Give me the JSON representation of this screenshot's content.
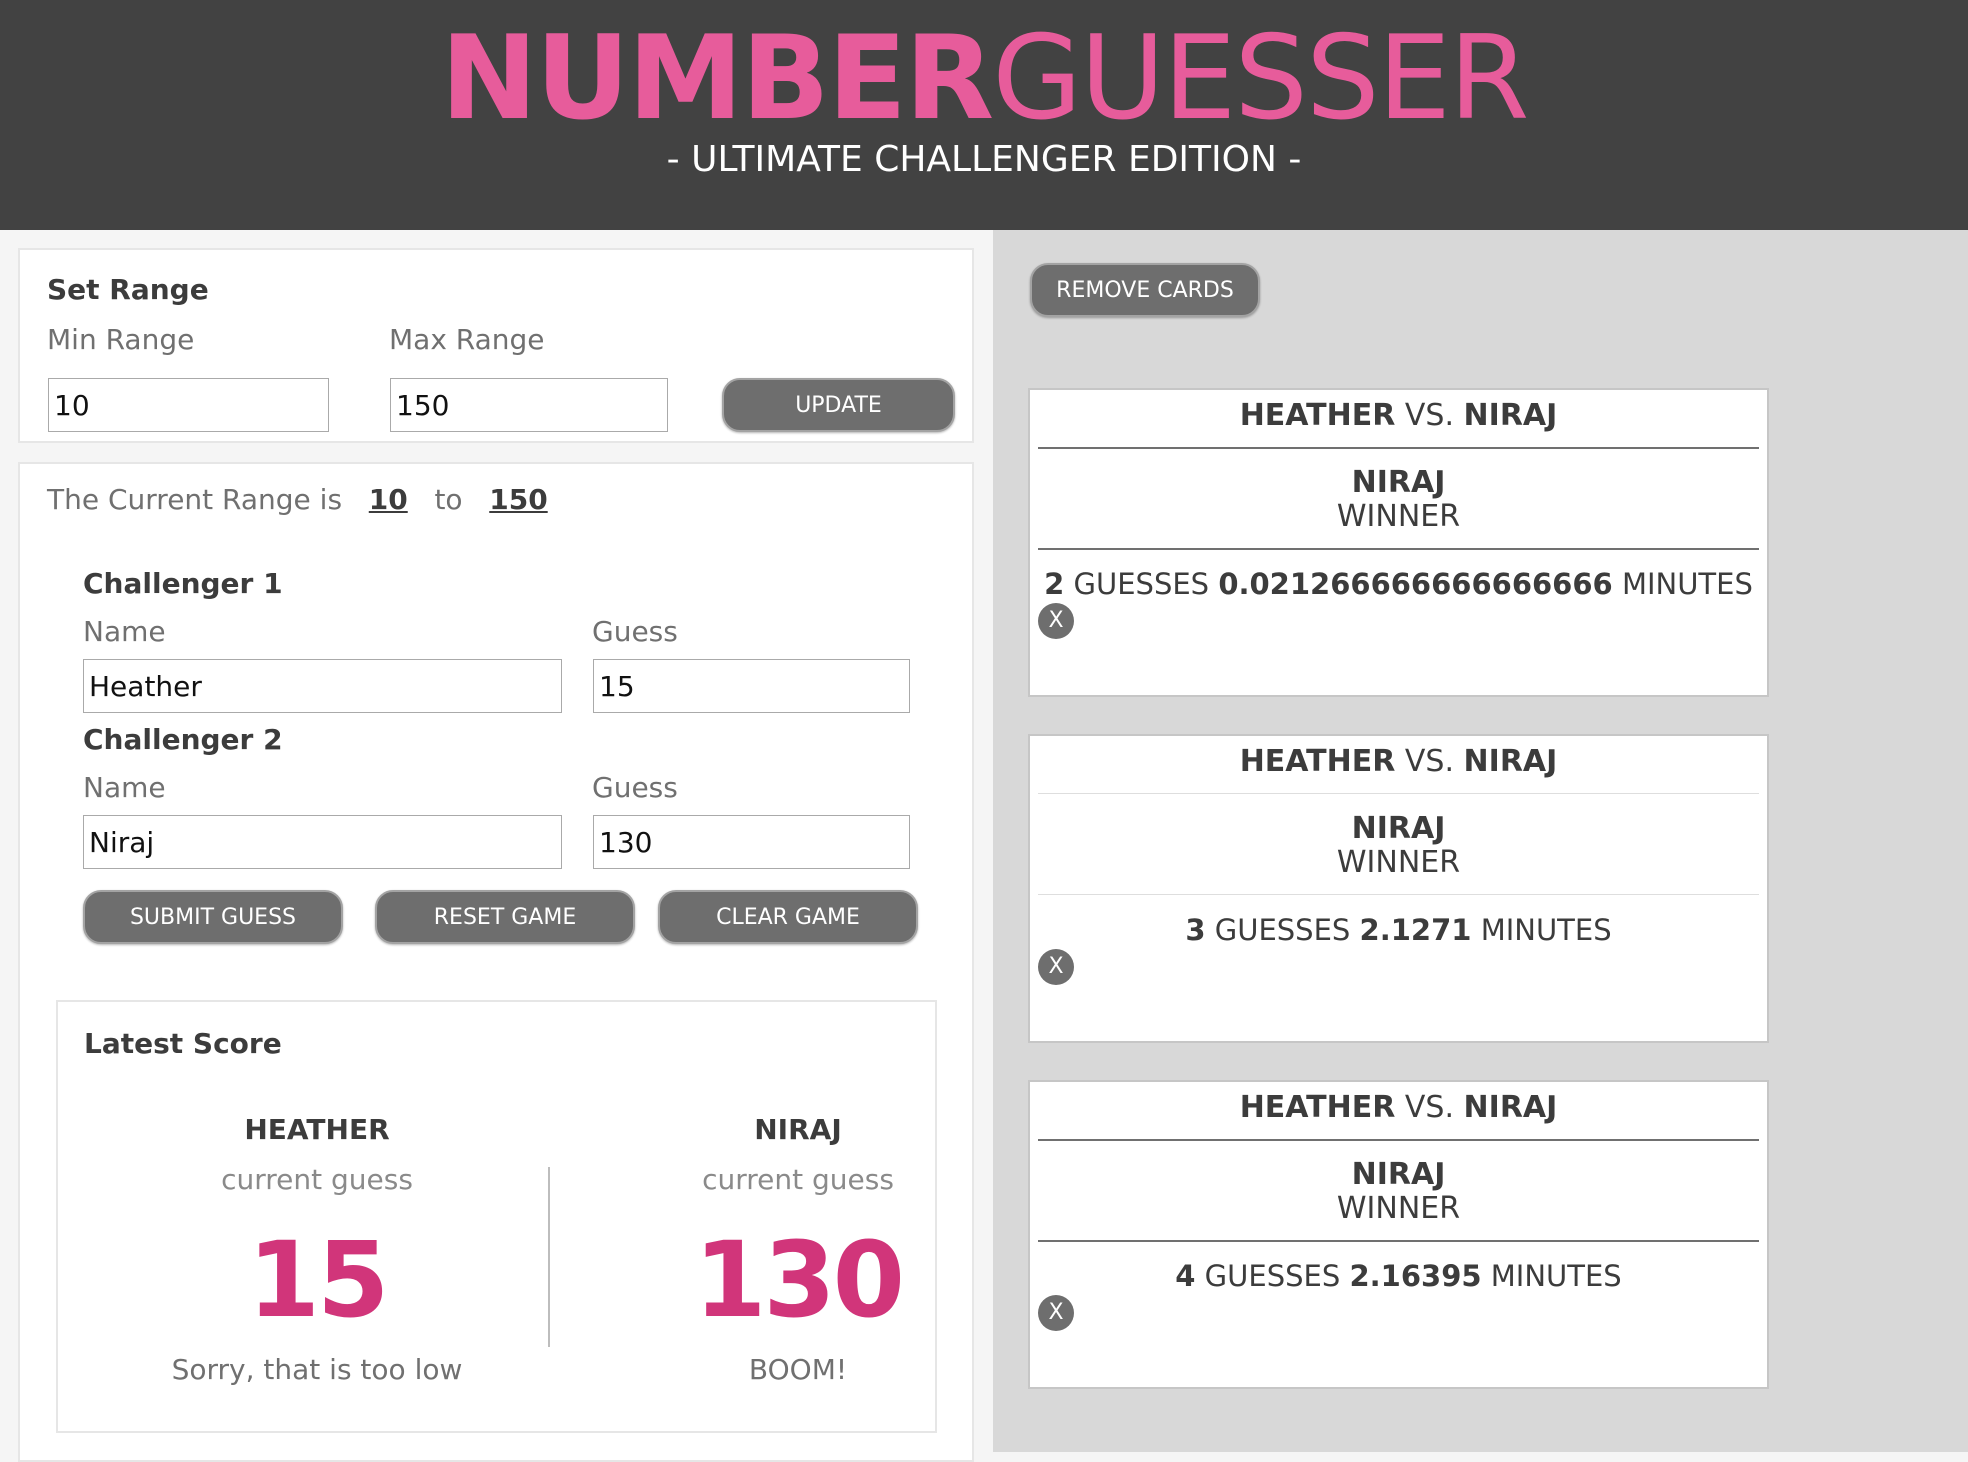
{
  "header": {
    "title_bold": "NUMBER",
    "title_light": "GUESSER",
    "subtitle": "-  ULTIMATE CHALLENGER EDITION -"
  },
  "colors": {
    "header_bg": "#424242",
    "brand_pink": "#e75c9b",
    "score_pink": "#d1357a",
    "button_gray": "#6e6e6e"
  },
  "set_range": {
    "heading": "Set Range",
    "min_label": "Min Range",
    "min_value": "10",
    "max_label": "Max Range",
    "max_value": "150",
    "update_button": "UPDATE"
  },
  "current_range": {
    "prefix": "The Current Range is",
    "min": "10",
    "separator": "to",
    "max": "150"
  },
  "challenger1": {
    "heading": "Challenger 1",
    "name_label": "Name",
    "name_value": "Heather",
    "guess_label": "Guess",
    "guess_value": "15"
  },
  "challenger2": {
    "heading": "Challenger 2",
    "name_label": "Name",
    "name_value": "Niraj",
    "guess_label": "Guess",
    "guess_value": "130"
  },
  "actions": {
    "submit": "SUBMIT GUESS",
    "reset": "RESET GAME",
    "clear": "CLEAR GAME"
  },
  "latest_score": {
    "heading": "Latest Score",
    "players": [
      {
        "name": "HEATHER",
        "caption": "current guess",
        "guess": "15",
        "feedback": "Sorry, that is too low"
      },
      {
        "name": "NIRAJ",
        "caption": "current guess",
        "guess": "130",
        "feedback": "BOOM!"
      }
    ]
  },
  "remove_cards_button": "REMOVE CARDS",
  "cards": [
    {
      "player1": "HEATHER",
      "vs": "VS.",
      "player2": "NIRAJ",
      "winner": "NIRAJ",
      "winner_label": "WINNER",
      "guesses": "2",
      "guesses_label": "GUESSES",
      "minutes": "0.021266666666666666",
      "minutes_label": "MINUTES",
      "close": "X"
    },
    {
      "player1": "HEATHER",
      "vs": "VS.",
      "player2": "NIRAJ",
      "winner": "NIRAJ",
      "winner_label": "WINNER",
      "guesses": "3",
      "guesses_label": "GUESSES",
      "minutes": "2.1271",
      "minutes_label": "MINUTES",
      "close": "X"
    },
    {
      "player1": "HEATHER",
      "vs": "VS.",
      "player2": "NIRAJ",
      "winner": "NIRAJ",
      "winner_label": "WINNER",
      "guesses": "4",
      "guesses_label": "GUESSES",
      "minutes": "2.16395",
      "minutes_label": "MINUTES",
      "close": "X"
    }
  ]
}
